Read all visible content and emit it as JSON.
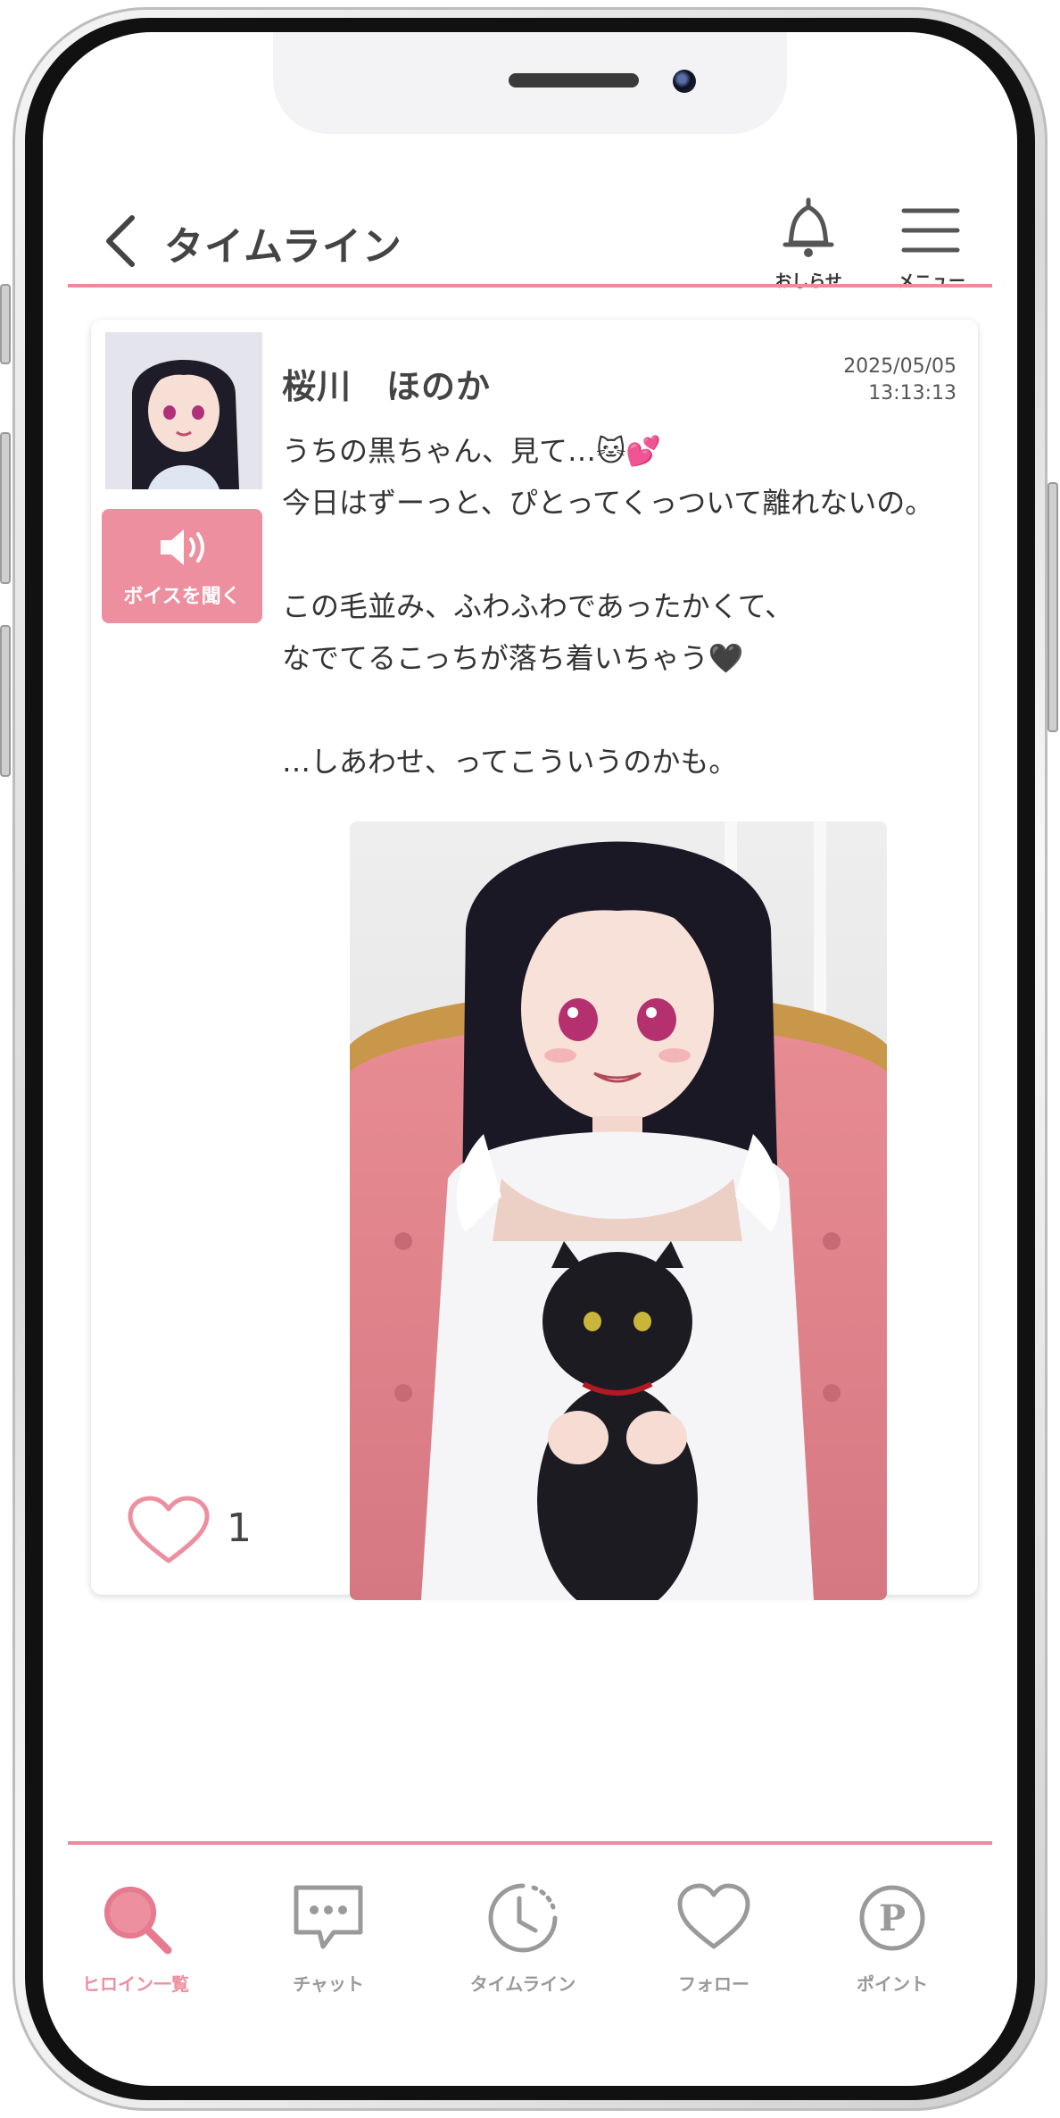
{
  "header": {
    "title": "タイムライン",
    "notifications_label": "おしらせ",
    "menu_label": "メニュー"
  },
  "post": {
    "author": "桜川　ほのか",
    "date": "2025/05/05",
    "time": "13:13:13",
    "voice_button_label": "ボイスを聞く",
    "body": "うちの黒ちゃん、見て…🐱💕\n今日はずーっと、ぴとってくっついて離れないの。\n\nこの毛並み、ふわふわであったかくて、\nなでてるこっちが落ち着いちゃう🖤\n\n…しあわせ、ってこういうのかも。",
    "like_count": "1"
  },
  "nav": {
    "items": [
      {
        "label": "ヒロイン一覧",
        "icon": "search-icon",
        "active": true
      },
      {
        "label": "チャット",
        "icon": "chat-icon",
        "active": false
      },
      {
        "label": "タイムライン",
        "icon": "clock-icon",
        "active": false
      },
      {
        "label": "フォロー",
        "icon": "heart-icon",
        "active": false
      },
      {
        "label": "ポイント",
        "icon": "point-icon",
        "active": false
      }
    ]
  },
  "colors": {
    "accent": "#ee8fa0",
    "line": "#ee8a9c",
    "inactive_icon": "#9a9a9a"
  }
}
